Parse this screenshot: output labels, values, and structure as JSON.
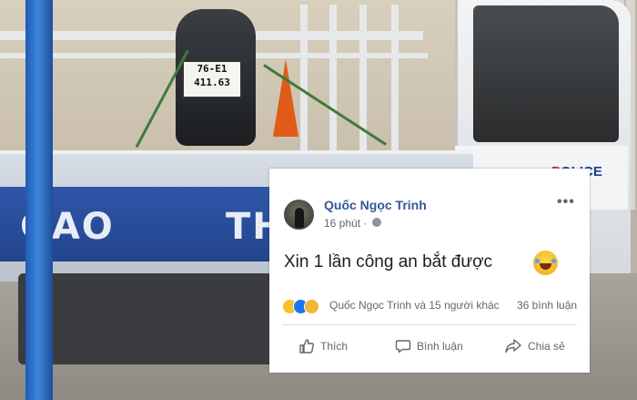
{
  "photo": {
    "license_plate_line1": "76-E1",
    "license_plate_line2": "411.63",
    "truck_text_left": "GAO",
    "truck_text_right": "TH",
    "cab_label_prefix": "P",
    "cab_label_rest": "OLICE"
  },
  "post": {
    "author_name": "Quốc Ngọc Trinh",
    "timestamp": "16 phút ·",
    "more_label": "•••",
    "message": "Xin 1 lần công an bắt được",
    "reactions_summary": "Quốc Ngọc Trinh và 15 người khác",
    "comments_count": "36 bình luận",
    "actions": {
      "like_label": "Thích",
      "comment_label": "Bình luận",
      "share_label": "Chia sẻ"
    }
  },
  "colors": {
    "facebook_link": "#365899",
    "secondary_text": "#606770",
    "police_blue": "#1d3d8e",
    "like_blue": "#1877f2",
    "haha_yellow": "#f7c12e"
  }
}
